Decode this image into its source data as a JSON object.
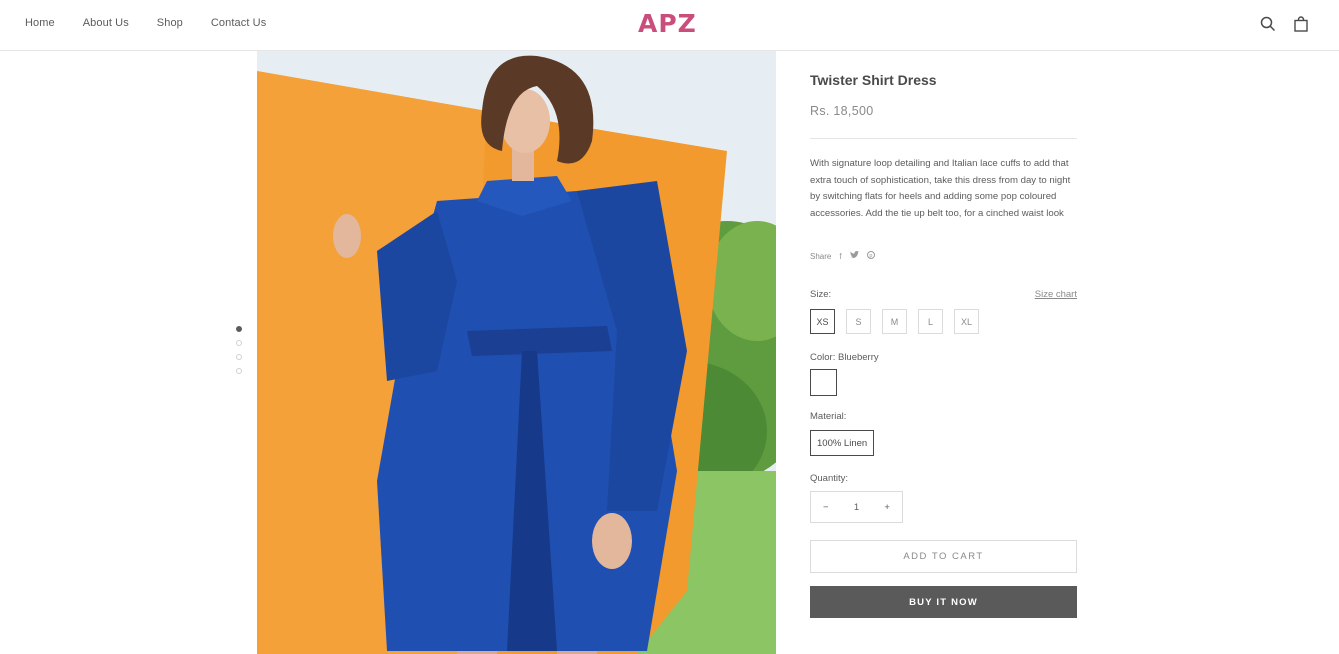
{
  "header": {
    "nav": [
      "Home",
      "About Us",
      "Shop",
      "Contact Us"
    ],
    "logo": "APZ",
    "icons": [
      "search-icon",
      "bag-icon"
    ]
  },
  "gallery": {
    "dots_total": 4,
    "active_dot": 1
  },
  "product": {
    "title": "Twister Shirt Dress",
    "price": "Rs. 18,500",
    "description": "With signature loop detailing and Italian lace cuffs to add that extra touch of sophistication, take this dress from day to night by switching flats for heels and adding some pop coloured accessories. Add the tie up belt too, for a cinched waist look",
    "share_label": "Share",
    "share_icons": [
      "facebook-icon",
      "twitter-icon",
      "pinterest-icon"
    ],
    "size_label": "Size:",
    "size_chart": "Size chart",
    "sizes": [
      "XS",
      "S",
      "M",
      "L",
      "XL"
    ],
    "selected_size": "XS",
    "color_label": "Color: Blueberry",
    "color_swatch": "#ffffff",
    "material_label": "Material:",
    "material_value": "100% Linen",
    "quantity_label": "Quantity:",
    "quantity_value": "1",
    "quantity_minus": "−",
    "quantity_plus": "+",
    "add_to_cart": "ADD TO CART",
    "buy_now": "BUY IT NOW"
  },
  "colors": {
    "logo": "#c94e7c",
    "buy_button": "#5a5a5a",
    "dress": "#1f4fb0",
    "wall": "#f29a2e",
    "grass": "#8cc563"
  }
}
